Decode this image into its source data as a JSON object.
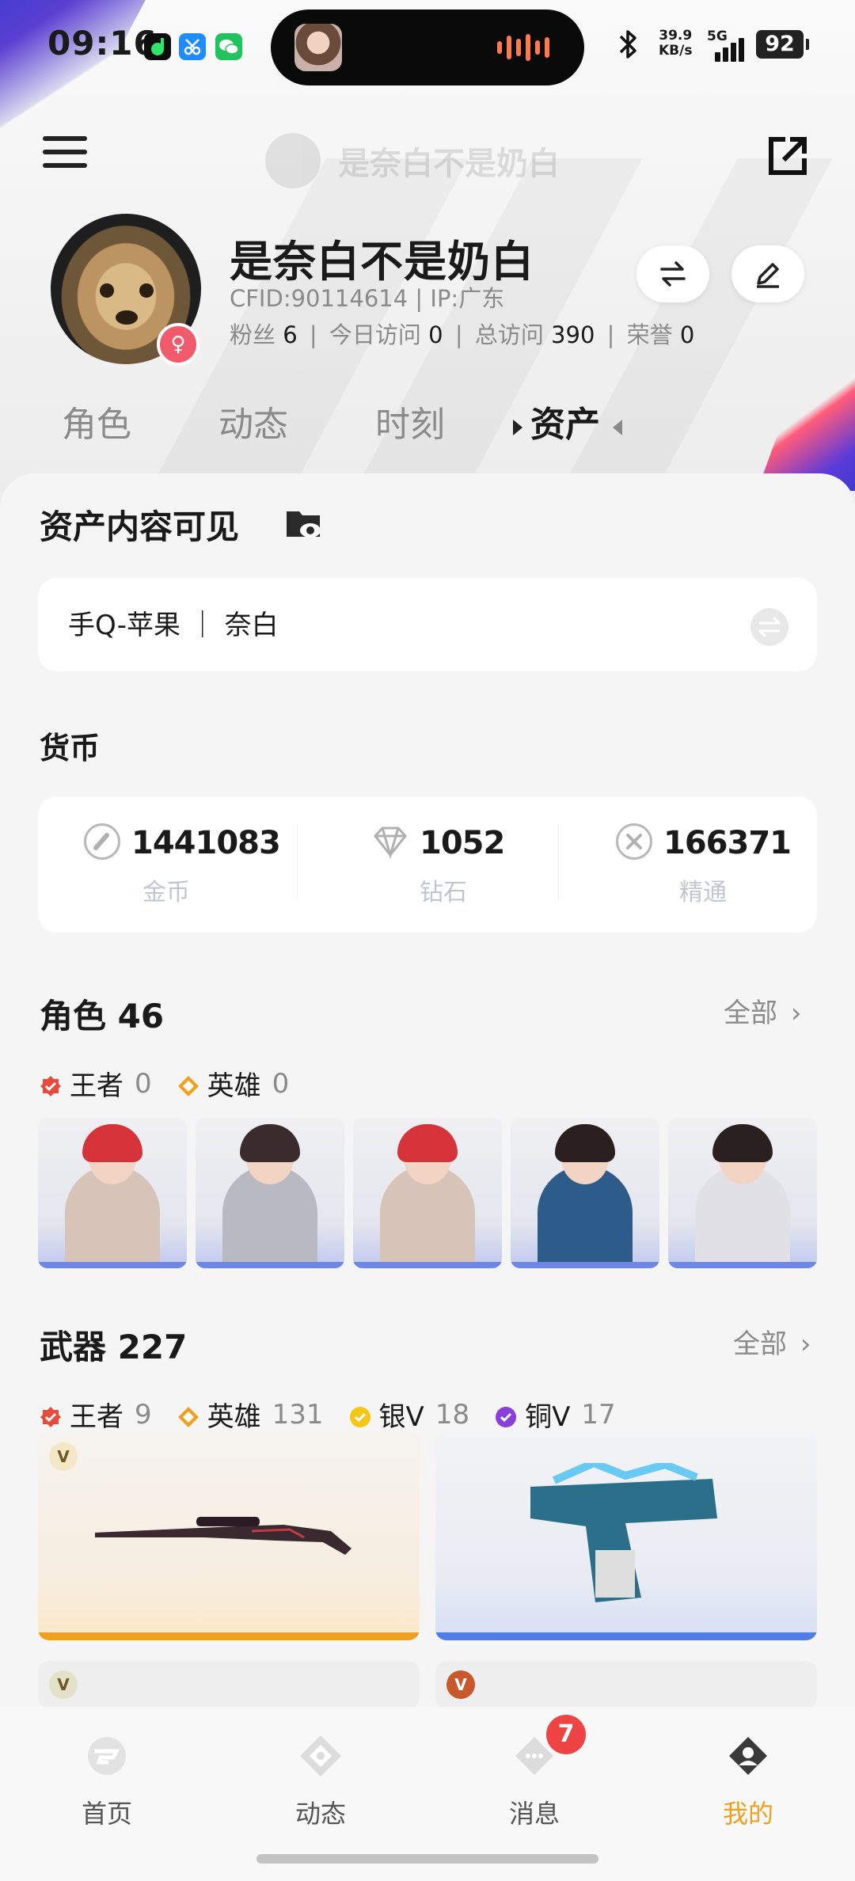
{
  "status": {
    "time": "09:16",
    "net_speed": "39.9",
    "net_unit": "KB/s",
    "signal_label": "5G",
    "battery": "92"
  },
  "header": {
    "ghost_title": "是奈白不是奶白"
  },
  "profile": {
    "name": "是奈白不是奶白",
    "cfid_line": "CFID:90114614 | IP:广东",
    "fans_label": "粉丝",
    "fans": "6",
    "today_label": "今日访问",
    "today": "0",
    "total_label": "总访问",
    "total": "390",
    "honor_label": "荣誉",
    "honor": "0"
  },
  "tabs": [
    "角色",
    "动态",
    "时刻",
    "资产"
  ],
  "active_tab": "资产",
  "assets": {
    "visibility_title": "资产内容可见",
    "account": "手Q-苹果 ｜ 奈白",
    "currency_title": "货币",
    "currencies": [
      {
        "value": "1441083",
        "label": "金币",
        "icon": "gold-coin-icon"
      },
      {
        "value": "1052",
        "label": "钻石",
        "icon": "diamond-icon"
      },
      {
        "value": "166371",
        "label": "精通",
        "icon": "mastery-icon"
      }
    ]
  },
  "roles": {
    "title": "角色 46",
    "more": "全部",
    "tags": [
      {
        "label": "王者",
        "count": "0",
        "color": "#e84a3c"
      },
      {
        "label": "英雄",
        "count": "0",
        "color": "#f0a020"
      }
    ]
  },
  "weapons": {
    "title": "武器 227",
    "more": "全部",
    "tags": [
      {
        "label": "王者",
        "count": "9",
        "color": "#e84a3c"
      },
      {
        "label": "英雄",
        "count": "131",
        "color": "#f0a020"
      },
      {
        "label": "银V",
        "count": "18",
        "color": "#f5c518"
      },
      {
        "label": "铜V",
        "count": "17",
        "color": "#8b3fd9"
      }
    ],
    "badge_letter": "V"
  },
  "nav": [
    {
      "label": "首页",
      "icon": "home-icon"
    },
    {
      "label": "动态",
      "icon": "feed-icon"
    },
    {
      "label": "消息",
      "icon": "message-icon",
      "badge": "7"
    },
    {
      "label": "我的",
      "icon": "profile-icon"
    }
  ]
}
